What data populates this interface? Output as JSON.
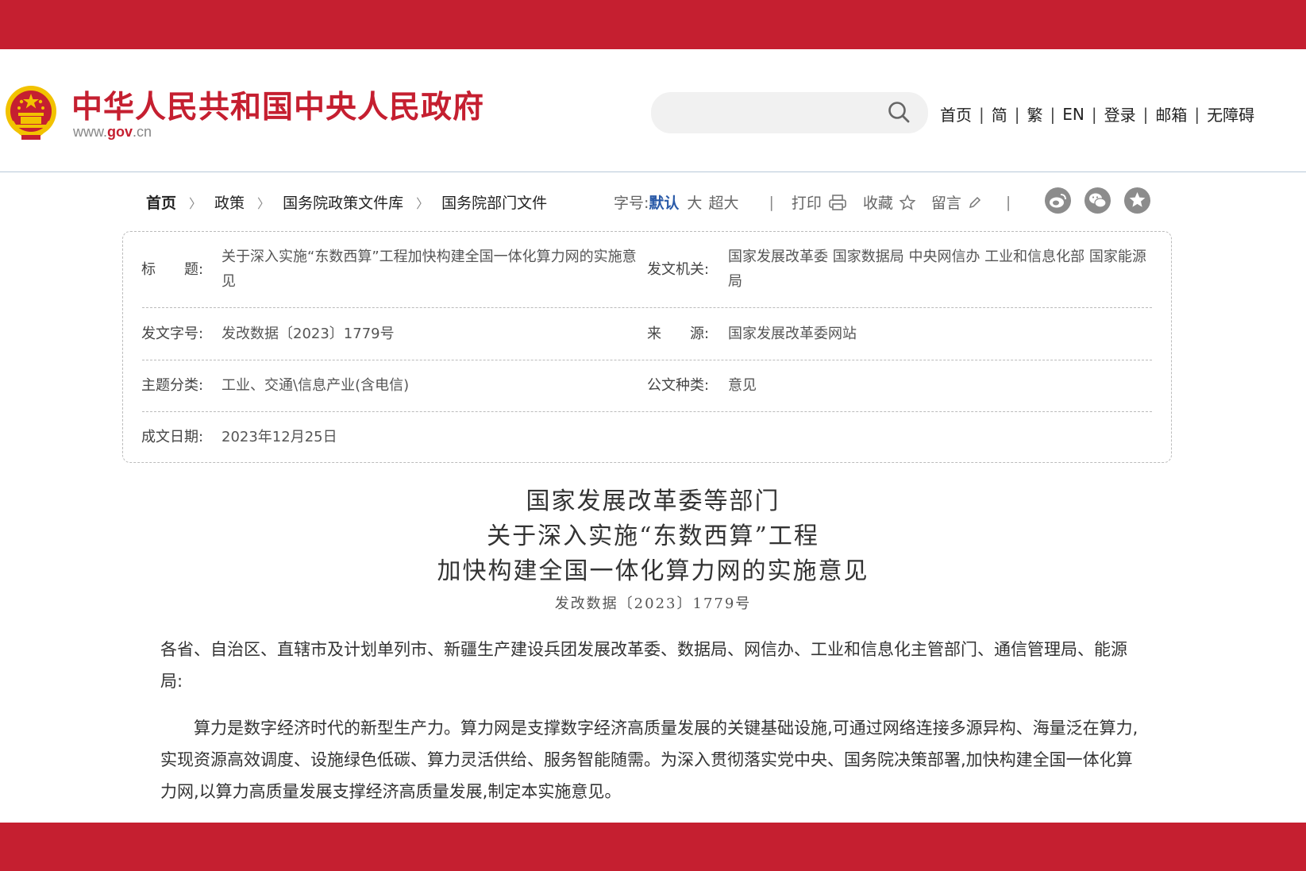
{
  "header": {
    "site_title": "中华人民共和国中央人民政府",
    "site_url_prefix": "www.",
    "site_url_brand": "gov",
    "site_url_suffix": ".cn",
    "search_placeholder": "",
    "nav": [
      "首页",
      "简",
      "繁",
      "EN",
      "登录",
      "邮箱",
      "无障碍"
    ],
    "nav_separator": "|"
  },
  "breadcrumb": {
    "items": [
      "首页",
      "政策",
      "国务院政策文件库",
      "国务院部门文件"
    ],
    "separator": ">"
  },
  "tools": {
    "font_size_label": "字号:",
    "font_sizes": [
      "默认",
      "大",
      "超大"
    ],
    "selected_font_size": "默认",
    "separator": "|",
    "print_label": "打印",
    "favorite_label": "收藏",
    "comment_label": "留言",
    "share_icons": [
      "weibo-icon",
      "wechat-icon",
      "favorite-star-icon"
    ]
  },
  "info": {
    "title_label": "标　　题:",
    "title_value": "关于深入实施“东数西算”工程加快构建全国一体化算力网的实施意见",
    "issuer_label": "发文机关:",
    "issuer_value": "国家发展改革委  国家数据局  中央网信办  工业和信息化部  国家能源局",
    "doc_number_label": "发文字号:",
    "doc_number_value": "发改数据〔2023〕1779号",
    "source_label": "来　　源:",
    "source_value": "国家发展改革委网站",
    "topic_label": "主题分类:",
    "topic_value": "工业、交通\\信息产业(含电信)",
    "doc_type_label": "公文种类:",
    "doc_type_value": "意见",
    "date_label": "成文日期:",
    "date_value": "2023年12月25日"
  },
  "document": {
    "title_lines": [
      "国家发展改革委等部门",
      "关于深入实施“东数西算”工程",
      "加快构建全国一体化算力网的实施意见"
    ],
    "doc_number": "发改数据〔2023〕1779号",
    "salutation": "各省、自治区、直辖市及计划单列市、新疆生产建设兵团发展改革委、数据局、网信办、工业和信息化主管部门、通信管理局、能源局:",
    "paragraph": "算力是数字经济时代的新型生产力。算力网是支撑数字经济高质量发展的关键基础设施,可通过网络连接多源异构、海量泛在算力,实现资源高效调度、设施绿色低碳、算力灵活供给、服务智能随需。为深入贯彻落实党中央、国务院决策部署,加快构建全国一体化算力网,以算力高质量发展支撑经济高质量发展,制定本实施意见。"
  },
  "colors": {
    "brand_red": "#c51f30",
    "link_blue": "#2a5aa8",
    "emblem_gold": "#f2c200"
  }
}
